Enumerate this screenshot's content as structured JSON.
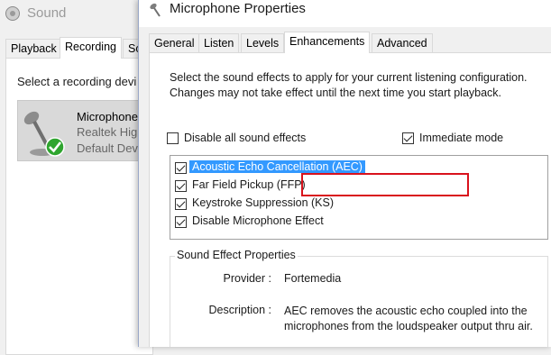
{
  "sound_window": {
    "title": "Sound",
    "tabs": [
      "Playback",
      "Recording",
      "So"
    ],
    "active_tab": "Recording",
    "hint": "Select a recording devi",
    "device": {
      "name": "Microphone",
      "driver": "Realtek High",
      "status": "Default Dev"
    }
  },
  "dialog": {
    "title": "Microphone Properties",
    "tabs": [
      "General",
      "Listen",
      "Levels",
      "Enhancements",
      "Advanced"
    ],
    "active_tab": "Enhancements",
    "description": "Select the sound effects to apply for your current listening configuration. Changes may not take effect until the next time you start playback.",
    "disable_all": {
      "label": "Disable all sound effects",
      "checked": false
    },
    "immediate_mode": {
      "label": "Immediate mode",
      "checked": true
    },
    "effects": [
      {
        "label": "Acoustic Echo Cancellation (AEC)",
        "checked": true,
        "selected": true
      },
      {
        "label": "Far Field Pickup (FFP)",
        "checked": true,
        "highlighted": true
      },
      {
        "label": "Keystroke Suppression (KS)",
        "checked": true
      },
      {
        "label": "Disable Microphone Effect",
        "checked": true
      }
    ],
    "properties_group": {
      "title": "Sound Effect Properties",
      "provider_label": "Provider :",
      "provider_value": "Fortemedia",
      "description_label": "Description :",
      "description_value": "AEC removes the acoustic echo coupled into the microphones from the loudspeaker output thru air."
    }
  },
  "colors": {
    "selection": "#3399ff",
    "annotation_box": "#d9121c",
    "status_check": "#2fa52f"
  }
}
